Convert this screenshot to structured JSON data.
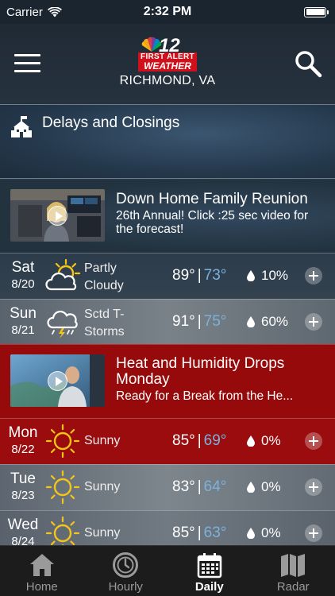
{
  "status_bar": {
    "carrier": "Carrier",
    "time": "2:32 PM",
    "battery_level": 1.0
  },
  "header": {
    "logo": {
      "number": "12",
      "line1": "FIRST ALERT",
      "line2": "WEATHER"
    },
    "location": "RICHMOND, VA",
    "menu_icon": "hamburger-menu-icon",
    "search_icon": "search-icon"
  },
  "delays": {
    "label": "Delays and Closings",
    "icon": "school-icon"
  },
  "promos": [
    {
      "title": "Down Home Family Reunion",
      "subtitle": "26th Annual! Click :25 sec video for the forecast!"
    },
    {
      "title": "Heat and Humidity Drops Monday",
      "subtitle": "Ready for a Break from the He..."
    }
  ],
  "forecast": [
    {
      "day": "Sat",
      "date": "8/20",
      "icon": "partly-cloudy-icon",
      "condition": "Partly Cloudy",
      "high": "89°",
      "low": "73°",
      "precip": "10%"
    },
    {
      "day": "Sun",
      "date": "8/21",
      "icon": "thunderstorm-icon",
      "condition": "Sctd T-Storms",
      "high": "91°",
      "low": "75°",
      "precip": "60%"
    },
    {
      "day": "Mon",
      "date": "8/22",
      "icon": "sunny-icon",
      "condition": "Sunny",
      "high": "85°",
      "low": "69°",
      "precip": "0%"
    },
    {
      "day": "Tue",
      "date": "8/23",
      "icon": "sunny-icon",
      "condition": "Sunny",
      "high": "83°",
      "low": "64°",
      "precip": "0%"
    },
    {
      "day": "Wed",
      "date": "8/24",
      "icon": "sunny-icon",
      "condition": "Sunny",
      "high": "85°",
      "low": "63°",
      "precip": "0%"
    }
  ],
  "tabs": [
    {
      "label": "Home",
      "icon": "home-icon",
      "active": false
    },
    {
      "label": "Hourly",
      "icon": "clock-icon",
      "active": false
    },
    {
      "label": "Daily",
      "icon": "calendar-icon",
      "active": true
    },
    {
      "label": "Radar",
      "icon": "map-icon",
      "active": false
    }
  ],
  "colors": {
    "alert_red": "#960a0b",
    "low_temp_blue": "#7bb2dd",
    "sun_yellow": "#f5c518"
  }
}
